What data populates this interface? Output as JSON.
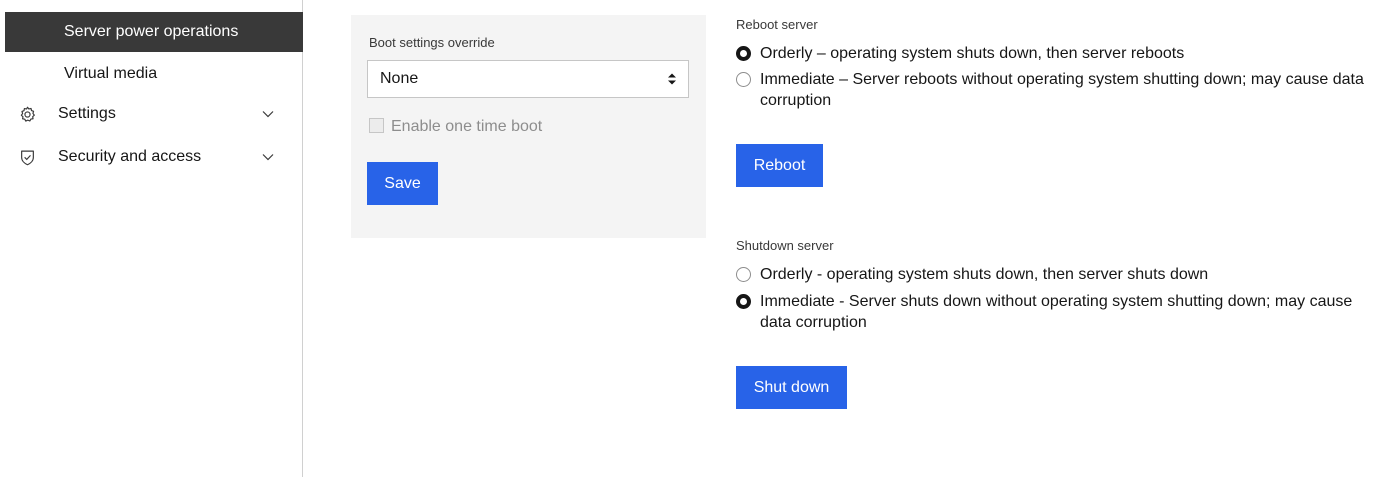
{
  "sidebar": {
    "active_item": "Server power operations",
    "sub_item": "Virtual media",
    "settings_label": "Settings",
    "security_label": "Security and access"
  },
  "boot": {
    "label": "Boot settings override",
    "selected": "None",
    "checkbox_label": "Enable one time boot",
    "save_label": "Save"
  },
  "reboot": {
    "title": "Reboot server",
    "option_orderly": "Orderly – operating system shuts down, then server reboots",
    "option_immediate_line1": "Immediate – Server reboots without operating system shutting down; may cause data",
    "option_immediate_line2": "corruption",
    "button_label": "Reboot"
  },
  "shutdown": {
    "title": "Shutdown server",
    "option_orderly": "Orderly - operating system shuts down, then server shuts down",
    "option_immediate_line1": "Immediate - Server shuts down without operating system shutting down; may cause",
    "option_immediate_line2": "data corruption",
    "button_label": "Shut down"
  },
  "colors": {
    "primary": "#2863e8",
    "nav_active_bg": "#393939",
    "panel_bg": "#f4f4f4"
  }
}
